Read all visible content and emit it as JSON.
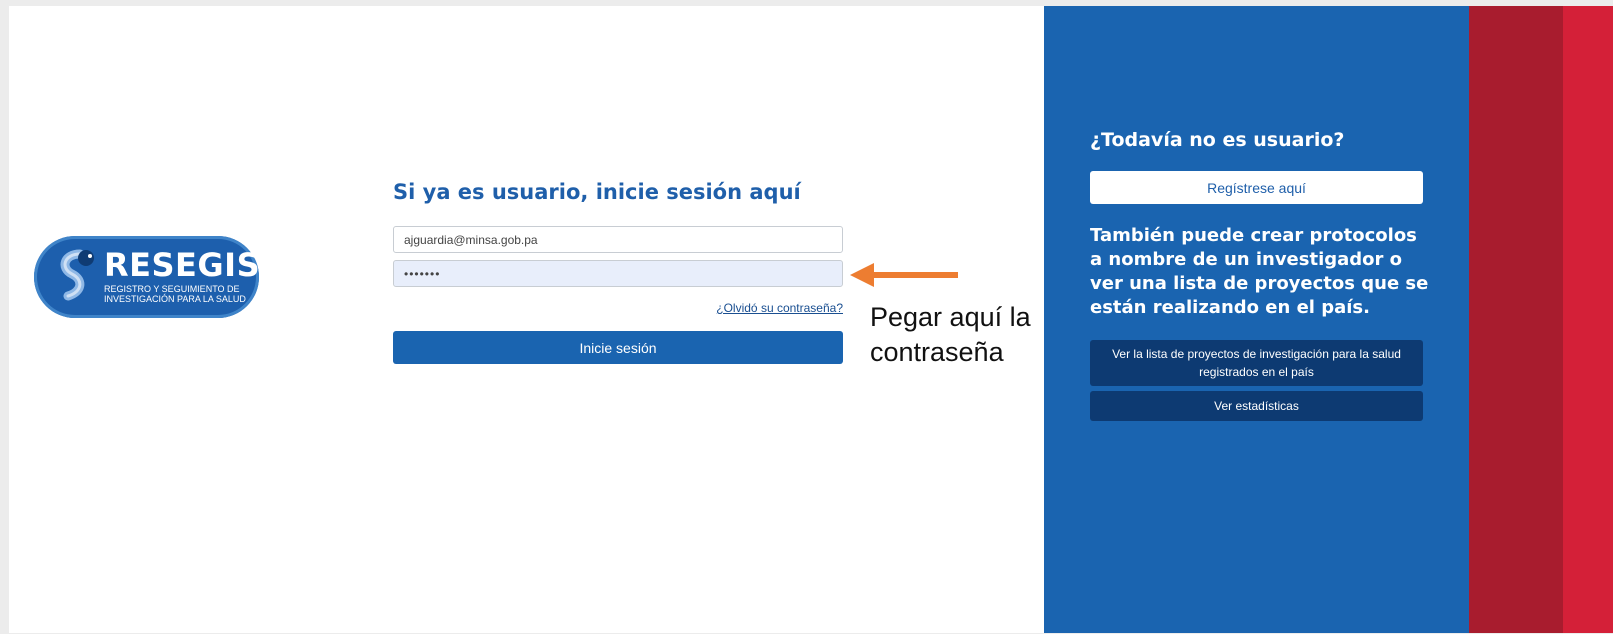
{
  "logo": {
    "title": "RESEGIS",
    "subtitle_line1": "REGISTRO Y SEGUIMIENTO DE",
    "subtitle_line2": "INVESTIGACIÓN PARA LA SALUD"
  },
  "login": {
    "heading": "Si ya es usuario, inicie sesión aquí",
    "email_value": "ajguardia@minsa.gob.pa",
    "password_value": "•••••••",
    "forgot_link": "¿Olvidó su contraseña?",
    "submit_label": "Inicie sesión"
  },
  "annotation": {
    "text": "Pegar aquí la contraseña",
    "arrow_color": "#ed7d31"
  },
  "signup": {
    "heading": "¿Todavía no es usuario?",
    "register_label": "Regístrese aquí",
    "also_text": "También puede crear protocolos a nombre de un investigador o ver una lista de proyectos que se están realizando en el país.",
    "projects_list_label": "Ver la lista de proyectos de investigación para la salud registrados en el país",
    "statistics_label": "Ver estadísticas"
  },
  "colors": {
    "brand_blue": "#1a64b0",
    "dark_blue": "#0d3a72",
    "maroon": "#a81c2e",
    "red": "#d42038"
  }
}
